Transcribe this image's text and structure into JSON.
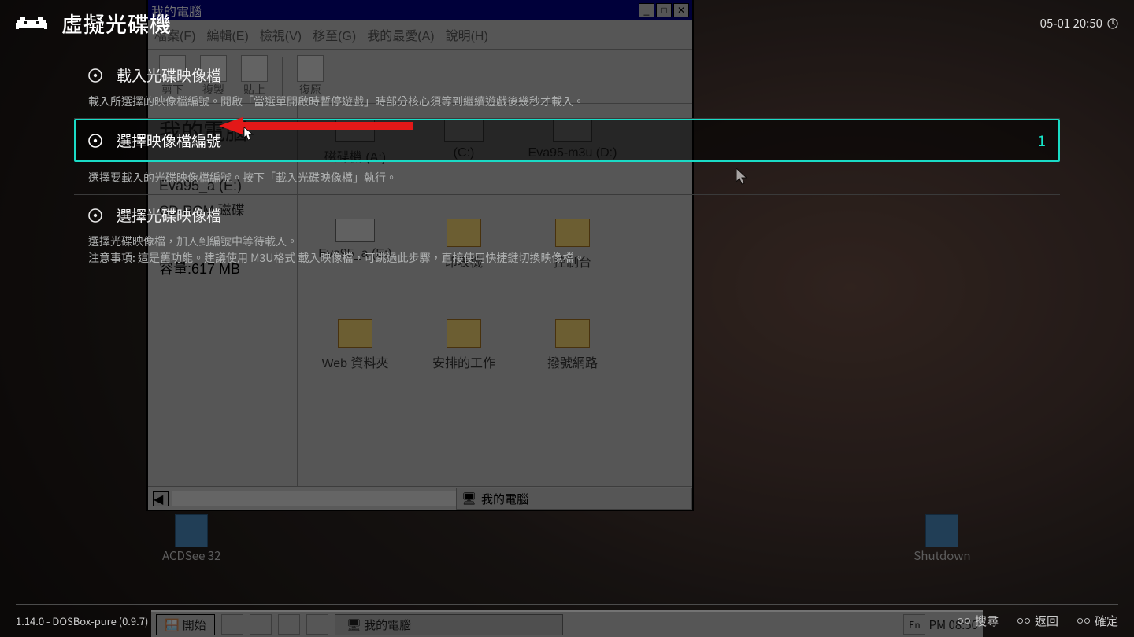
{
  "header": {
    "title": "虛擬光碟機"
  },
  "clock": {
    "text": "05-01 20:50"
  },
  "menu": {
    "items": [
      {
        "label": "載入光碟映像檔",
        "sublabel": "載入所選擇的映像檔編號。開啟「當選單開啟時暫停遊戲」時部分核心須等到繼續遊戲後幾秒才載入。",
        "value": "",
        "selected": false
      },
      {
        "label": "選擇映像檔編號",
        "sublabel": "選擇要載入的光碟映像檔編號。按下「載入光碟映像檔」執行。",
        "value": "1",
        "selected": true
      },
      {
        "label": "選擇光碟映像檔",
        "sublabel": "選擇光碟映像檔，加入到編號中等待載入。\n注意事項: 這是舊功能。建議使用 M3U格式 載入映像檔，可跳過此步驟，直接使用快捷鍵切換映像檔。",
        "value": "",
        "selected": false
      }
    ]
  },
  "footer": {
    "version": "1.14.0 - DOSBox-pure (0.9.7)",
    "hints": [
      {
        "label": "搜尋"
      },
      {
        "label": "返回"
      },
      {
        "label": "確定"
      }
    ]
  },
  "bg": {
    "win": {
      "title": "我的電腦",
      "menus": [
        "檔案(F)",
        "編輯(E)",
        "檢視(V)",
        "移至(G)",
        "我的最愛(A)",
        "說明(H)"
      ],
      "tools": [
        "剪下",
        "複製",
        "貼上",
        "復原"
      ],
      "side_title": "我的電腦",
      "sel_name": "Eva95_a (E:)",
      "sel_type": "CD-ROM 磁碟",
      "sel_cap": "容量:617 MB",
      "icons": [
        {
          "label": "磁碟機 (A:)",
          "kind": "drive"
        },
        {
          "label": "(C:)",
          "kind": "drive"
        },
        {
          "label": "Eva95-m3u (D:)",
          "kind": "drive"
        },
        {
          "label": "Eva95_a (E:)",
          "kind": "drive"
        },
        {
          "label": "印表機",
          "kind": "folder"
        },
        {
          "label": "控制台",
          "kind": "folder"
        },
        {
          "label": "Web 資料夾",
          "kind": "folder"
        },
        {
          "label": "安排的工作",
          "kind": "folder"
        },
        {
          "label": "撥號網路",
          "kind": "folder"
        }
      ],
      "status": "我的電腦"
    },
    "desktop_icons": [
      {
        "label": "ACDSee 32"
      },
      {
        "label": "Shutdown"
      }
    ],
    "taskbar": {
      "start": "開始",
      "task": "我的電腦",
      "tray_lang": "En",
      "tray_time": "PM 08:50"
    }
  }
}
